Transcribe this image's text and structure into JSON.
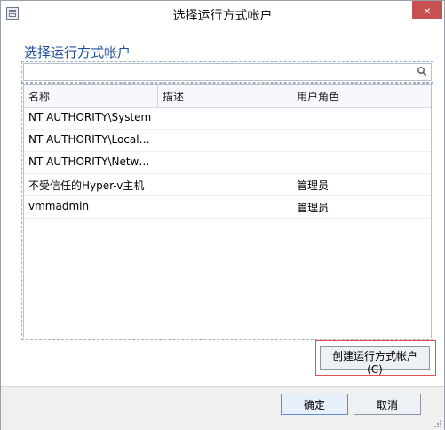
{
  "window": {
    "title": "选择运行方式帐户",
    "close_label": "×"
  },
  "dialog": {
    "heading": "选择运行方式帐户"
  },
  "search": {
    "placeholder": "",
    "value": ""
  },
  "table": {
    "headers": [
      "名称",
      "描述",
      "用户角色"
    ],
    "rows": [
      {
        "name": "NT AUTHORITY\\System",
        "description": "",
        "role": ""
      },
      {
        "name": "NT AUTHORITY\\LocalService",
        "description": "",
        "role": ""
      },
      {
        "name": "NT AUTHORITY\\NetworkService",
        "description": "",
        "role": ""
      },
      {
        "name": "不受信任的Hyper-v主机",
        "description": "",
        "role": "管理员"
      },
      {
        "name": "vmmadmin",
        "description": "",
        "role": "管理员"
      }
    ]
  },
  "actions": {
    "create_label": "创建运行方式帐户(C)",
    "ok_label": "确定",
    "cancel_label": "取消"
  },
  "colors": {
    "heading": "#1f4e9d",
    "highlight": "#e24f4f"
  },
  "icons": {
    "window": "window-app-icon",
    "search": "search-icon",
    "close": "close-icon"
  }
}
